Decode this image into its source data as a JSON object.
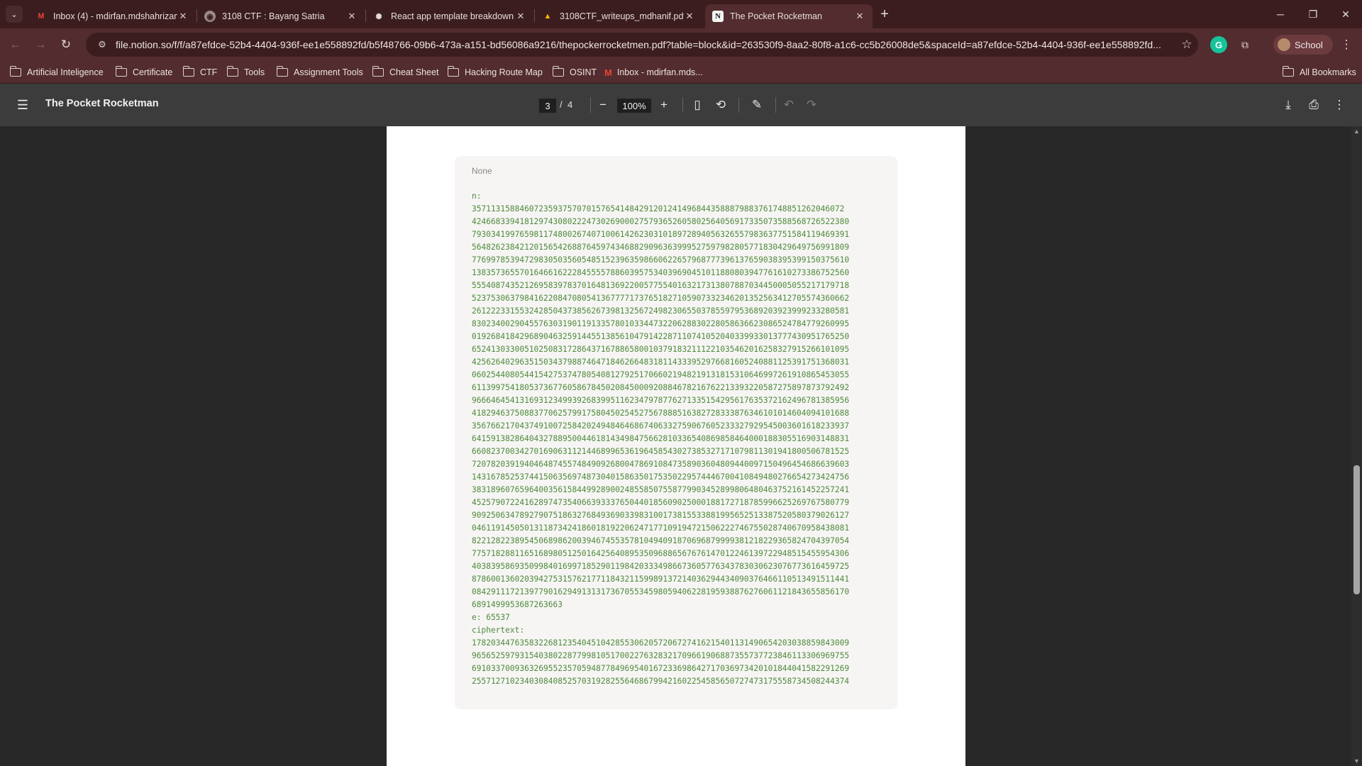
{
  "tabs": [
    {
      "title": "Inbox (4) - mdirfan.mdshahrizan",
      "icon": "gmail-icon"
    },
    {
      "title": "3108 CTF : Bayang Satria",
      "icon": "globe-icon"
    },
    {
      "title": "React app template breakdown",
      "icon": "openai-icon"
    },
    {
      "title": "3108CTF_writeups_mdhanif.pdf",
      "icon": "google-drive-icon"
    },
    {
      "title": "The Pocket Rocketman",
      "icon": "notion-icon",
      "active": true
    }
  ],
  "address_bar": {
    "url": "file.notion.so/f/f/a87efdce-52b4-4404-936f-ee1e558892fd/b5f48766-09b6-473a-a151-bd56086a9216/thepockerrocketmen.pdf?table=block&id=263530f9-8aa2-80f8-a1c6-cc5b26008de5&spaceId=a87efdce-52b4-4404-936f-ee1e558892fd..."
  },
  "profile": {
    "label": "School"
  },
  "bookmarks": [
    {
      "label": "Artificial Inteligence",
      "icon": "folder-icon"
    },
    {
      "label": "Certificate",
      "icon": "folder-icon"
    },
    {
      "label": "CTF",
      "icon": "folder-icon"
    },
    {
      "label": "Tools",
      "icon": "folder-icon"
    },
    {
      "label": "Assignment Tools",
      "icon": "folder-icon"
    },
    {
      "label": "Cheat Sheet",
      "icon": "folder-icon"
    },
    {
      "label": "Hacking Route Map",
      "icon": "folder-icon"
    },
    {
      "label": "OSINT",
      "icon": "folder-icon"
    },
    {
      "label": "Inbox - mdirfan.mds...",
      "icon": "gmail-icon"
    }
  ],
  "all_bookmarks": "All Bookmarks",
  "pdf": {
    "title": "The Pocket Rocketman",
    "current_page": "3",
    "page_separator": "/",
    "total_pages": "4",
    "zoom": "100%"
  },
  "code_block": {
    "language": "None",
    "content": "n:\n357113158846072359375707015765414842912012414968443588879883761748851262046072\n4246683394181297430802224730269000275793652605802564056917335073588568726522380\n7930341997659811748002674071006142623031018972894056326557983637751584119469391\n5648262384212015654268876459743468829096363999527597982805771830429649756991809\n7769978539472983050356054851523963598660622657968777396137659038395399150375610\n1383573655701646616222845555788603957534039690451011880803947761610273386752560\n5554087435212695839783701648136922005775540163217313807887034450005055217179718\n5237530637984162208470805413677771737651827105907332346201352563412705574360662\n2612223315532428504373856267398132567249823065503785597953689203923999233280581\n8302340029045576303190119133578010334473220628830228058636623086524784779260995\n0192684184296890463259144551385610479142287110741052040339933013777430951765250\n6524130330051025083172864371678865800103791832111221035462016258327915266101095\n4256264029635150343798874647184626648318114333952976681605240881125391751368031\n0602544080544154275374780540812792517066021948219131815310646997261910865453055\n6113997541805373677605867845020845000920884678216762213393220587275897873792492\n9666464541316931234993926839951162347978776271335154295617635372162496781385956\n4182946375088377062579917580450254527567888516382728333876346101014604094101688\n3567662170437491007258420249484646867406332759067605233327929545003601618233937\n6415913828640432788950044618143498475662810336540869858464000188305516903148831\n6608237003427016906311214468996536196458543027385327171079811301941800506781525\n7207820391940464874557484909268004786910847358903604809440097150496454686639603\n1431678525374415063569748730401586350175350229574446700410849480276654273424756\n3831896076596400356158449928900248558507558779903452899806480463752161452257241\n4525790722416289747354066393337650440185609025000188172718785996625269767580779\n9092506347892790751863276849369033983100173815533881995652513387520580379026127\n0461191450501311873424186018192206247177109194721506222746755028740670958438081\n8221282238954506898620039467455357810494091870696879999381218229365824704397054\n7757182881165168980512501642564089535096886567676147012246139722948515455954306\n4038395869350998401699718529011984203334986673605776343783030623076773616459725\n8786001360203942753157621771184321159989137214036294434090376466110513491511441\n0842911172139779016294913131736705534598059406228195938876276061121843655856170\n6891499953687263663\ne: 65537\nciphertext:\n1782034476358322681235404510428553062057206727416215401131490654203038859843009\n9656525979315403802287799810517002276328321709661906887355737723846113306969755\n6910337009363269552357059487784969540167233698642717036973420101844041582291269\n2557127102340308408525703192825564686799421602254585650727473175558734508244374"
  }
}
